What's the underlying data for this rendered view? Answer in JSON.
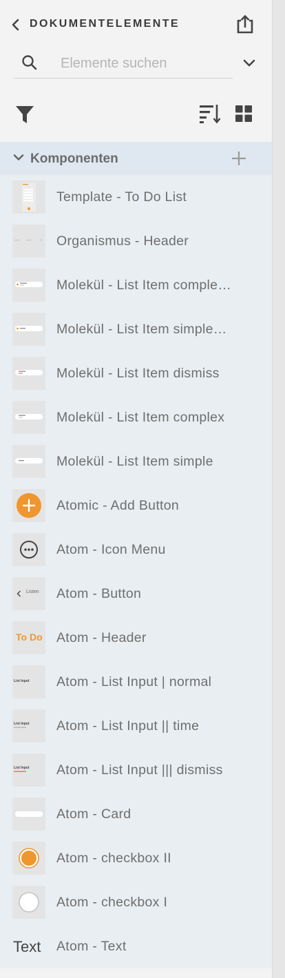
{
  "header": {
    "title": "DOKUMENTELEMENTE",
    "back_icon": "chevron-left-icon",
    "share_icon": "share-icon"
  },
  "search": {
    "placeholder": "Elemente suchen",
    "value": ""
  },
  "toolbar": {
    "filter_icon": "filter-icon",
    "sort_icon": "sort-icon",
    "grid_icon": "grid-view-icon"
  },
  "section": {
    "title": "Komponenten",
    "expanded": true
  },
  "items": [
    {
      "label": "Template - To Do List",
      "thumb": "template"
    },
    {
      "label": "Organismus - Header",
      "thumb": "header"
    },
    {
      "label": "Molekül - List Item comple…",
      "thumb": "list-complex-dot"
    },
    {
      "label": "Molekül - List Item simple…",
      "thumb": "list-simple-dot"
    },
    {
      "label": "Molekül - List Item dismiss",
      "thumb": "list-dismiss"
    },
    {
      "label": "Molekül - List Item complex",
      "thumb": "list-complex"
    },
    {
      "label": "Molekül - List Item simple",
      "thumb": "list-simple"
    },
    {
      "label": "Atomic - Add Button",
      "thumb": "add-button"
    },
    {
      "label": "Atom - Icon Menu",
      "thumb": "icon-menu"
    },
    {
      "label": "Atom - Button",
      "thumb": "button",
      "thumb_text": "Listen"
    },
    {
      "label": "Atom - Header",
      "thumb": "atom-header",
      "thumb_text": "To Do"
    },
    {
      "label": "Atom - List Input | normal",
      "thumb": "list-input",
      "thumb_text": "List Input"
    },
    {
      "label": "Atom - List Input || time",
      "thumb": "list-input-time",
      "thumb_text": "List Input"
    },
    {
      "label": "Atom - List Input ||| dismiss",
      "thumb": "list-input-dismiss",
      "thumb_text": "List Input"
    },
    {
      "label": "Atom - Card",
      "thumb": "card"
    },
    {
      "label": "Atom - checkbox II",
      "thumb": "checkbox-checked"
    },
    {
      "label": "Atom - checkbox I",
      "thumb": "checkbox-empty"
    },
    {
      "label": "Atom - Text",
      "thumb": "text",
      "thumb_text": "Text"
    }
  ],
  "colors": {
    "accent": "#f0962e",
    "section_bg": "#dfe8f1",
    "list_bg": "#e9eef2",
    "panel_bg": "#f3f3f3"
  }
}
